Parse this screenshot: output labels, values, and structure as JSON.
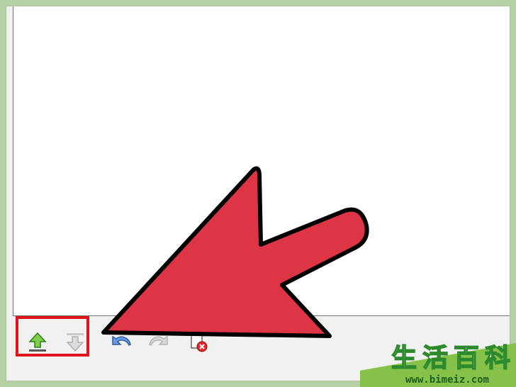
{
  "toolbar": {
    "buttons": [
      {
        "name": "move-up",
        "icon": "arrow-up-icon",
        "color": "#3f9a28",
        "enabled": true
      },
      {
        "name": "move-down",
        "icon": "arrow-down-icon",
        "color": "#bdbdbd",
        "enabled": false
      },
      {
        "name": "undo",
        "icon": "undo-icon",
        "color": "#3e6fb3",
        "enabled": true
      },
      {
        "name": "redo",
        "icon": "redo-icon",
        "color": "#bdbdbd",
        "enabled": false
      },
      {
        "name": "delete",
        "icon": "delete-document-icon",
        "color": "#d81a1a",
        "enabled": true
      }
    ]
  },
  "annotation": {
    "arrow_color": "#dd3545",
    "highlight_color": "#e0141c"
  },
  "watermark": {
    "chars": [
      "生",
      "活",
      "百",
      "科"
    ],
    "url": "www.bimeiz.com",
    "color": "#2c8a2c"
  }
}
